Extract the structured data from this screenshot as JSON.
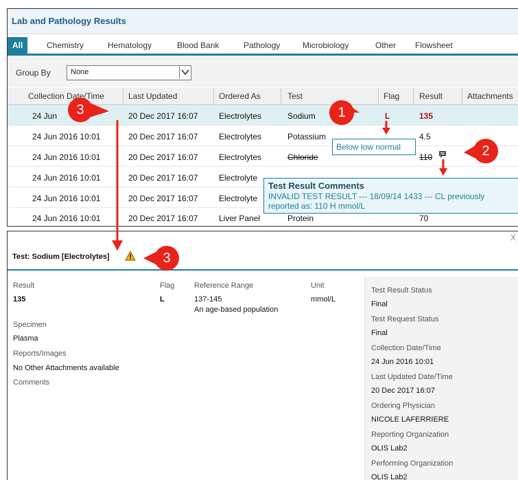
{
  "panel_title": "Lab and Pathology Results",
  "tabs": [
    {
      "label": "All",
      "active": true
    },
    {
      "label": "Chemistry"
    },
    {
      "label": "Hematology"
    },
    {
      "label": "Blood Bank"
    },
    {
      "label": "Pathology"
    },
    {
      "label": "Microbiology"
    },
    {
      "label": "Other"
    },
    {
      "label": "Flowsheet"
    }
  ],
  "group_by": {
    "label": "Group By",
    "value": "None"
  },
  "columns": [
    "Collection Date/Time",
    "Last Updated",
    "Ordered As",
    "Test",
    "Flag",
    "Result",
    "Attachments"
  ],
  "rows": [
    {
      "collection": "24 Jun",
      "updated": "20 Dec 2017 16:07",
      "ordered": "Electrolytes",
      "test": "Sodium",
      "flag": "L",
      "result": "135"
    },
    {
      "collection": "24 Jun 2016 10:01",
      "updated": "20 Dec 2017 16:07",
      "ordered": "Electrolytes",
      "test": "Potassium",
      "flag": "",
      "result": "4.5"
    },
    {
      "collection": "24 Jun 2016 10:01",
      "updated": "20 Dec 2017 16:07",
      "ordered": "Electrolytes",
      "test": "Chloride",
      "flag": "",
      "result": "110"
    },
    {
      "collection": "24 Jun 2016 10:01",
      "updated": "20 Dec 2017 16:07",
      "ordered": "Electrolyte",
      "test": "",
      "flag": "",
      "result": ""
    },
    {
      "collection": "24 Jun 2016 10:01",
      "updated": "20 Dec 2017 16:07",
      "ordered": "Electrolyte",
      "test": "",
      "flag": "",
      "result": ""
    },
    {
      "collection": "24 Jun 2016 10:01",
      "updated": "20 Dec 2017 16:07",
      "ordered": "Liver Panel",
      "test": "Protein",
      "flag": "",
      "result": "70"
    }
  ],
  "tooltip_low": "Below low normal",
  "tooltip_comments": {
    "title": "Test Result Comments",
    "line1": "INVALID TEST RESULT --- 18/09/14 1433 --- CL previously",
    "line2": "reported as: 110 H mmol/L"
  },
  "detail": {
    "title": "Test: Sodium [Electrolytes]",
    "close": "X",
    "result_label": "Result",
    "result_value": "135",
    "flag_label": "Flag",
    "flag_value": "L",
    "range_label": "Reference Range",
    "range_value": "137-145",
    "range_note": "An age-based population",
    "unit_label": "Unit",
    "unit_value": "mmol/L",
    "specimen_label": "Specimen",
    "specimen_value": "Plasma",
    "reports_label": "Reports/Images",
    "reports_value": "No Other Attachments available",
    "comments_label": "Comments",
    "status": [
      {
        "label": "Test Result Status",
        "value": "Final"
      },
      {
        "label": "Test Request Status",
        "value": "Final"
      },
      {
        "label": "Collection Date/Time",
        "value": "24 Jun 2016 10:01"
      },
      {
        "label": "Last Updated Date/Time",
        "value": "20 Dec 2017 16:07"
      },
      {
        "label": "Ordering Physician",
        "value": "NICOLE LAFERRIERE"
      },
      {
        "label": "Reporting Organization",
        "value": "OLIS Lab2"
      },
      {
        "label": "Performing Organization",
        "value": "OLIS Lab2"
      }
    ]
  },
  "callouts": [
    "1",
    "2",
    "3",
    "3"
  ],
  "colors": {
    "accent": "#1e7f9c",
    "flag_red": "#b4121b",
    "callout_red": "#e8231a"
  }
}
